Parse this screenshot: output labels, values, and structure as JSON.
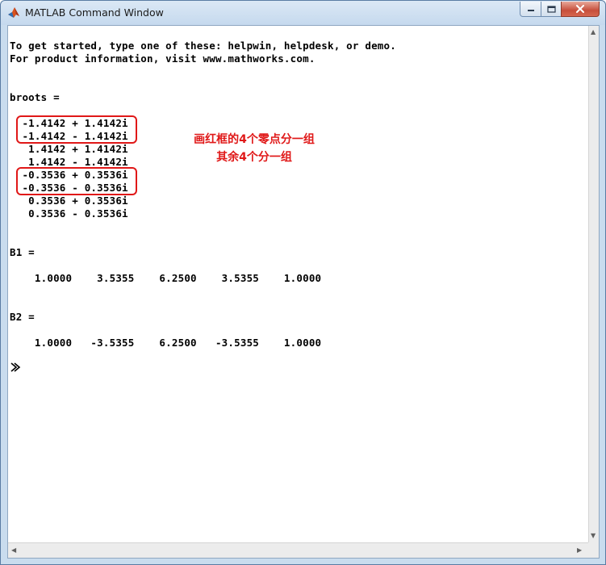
{
  "window": {
    "title": "MATLAB Command Window"
  },
  "icons": {
    "app": "matlab-logo-icon",
    "minimize": "minimize-icon",
    "maximize": "maximize-icon",
    "close": "close-icon",
    "prompt": "command-prompt-icon"
  },
  "colors": {
    "annotation": "#e01818",
    "close_button": "#c74f3c"
  },
  "console": {
    "intro": [
      "To get started, type one of these: helpwin, helpdesk, or demo.",
      "For product information, visit www.mathworks.com."
    ],
    "broots_label": "broots =",
    "broots": [
      "  -1.4142 + 1.4142i",
      "  -1.4142 - 1.4142i",
      "   1.4142 + 1.4142i",
      "   1.4142 - 1.4142i",
      "  -0.3536 + 0.3536i",
      "  -0.3536 - 0.3536i",
      "   0.3536 + 0.3536i",
      "   0.3536 - 0.3536i"
    ],
    "b1_label": "B1 =",
    "b1_values": "    1.0000    3.5355    6.2500    3.5355    1.0000",
    "b2_label": "B2 =",
    "b2_values": "    1.0000   -3.5355    6.2500   -3.5355    1.0000"
  },
  "annotation": {
    "line1": "画红框的4个零点分一组",
    "line2": "其余4个分一组"
  }
}
